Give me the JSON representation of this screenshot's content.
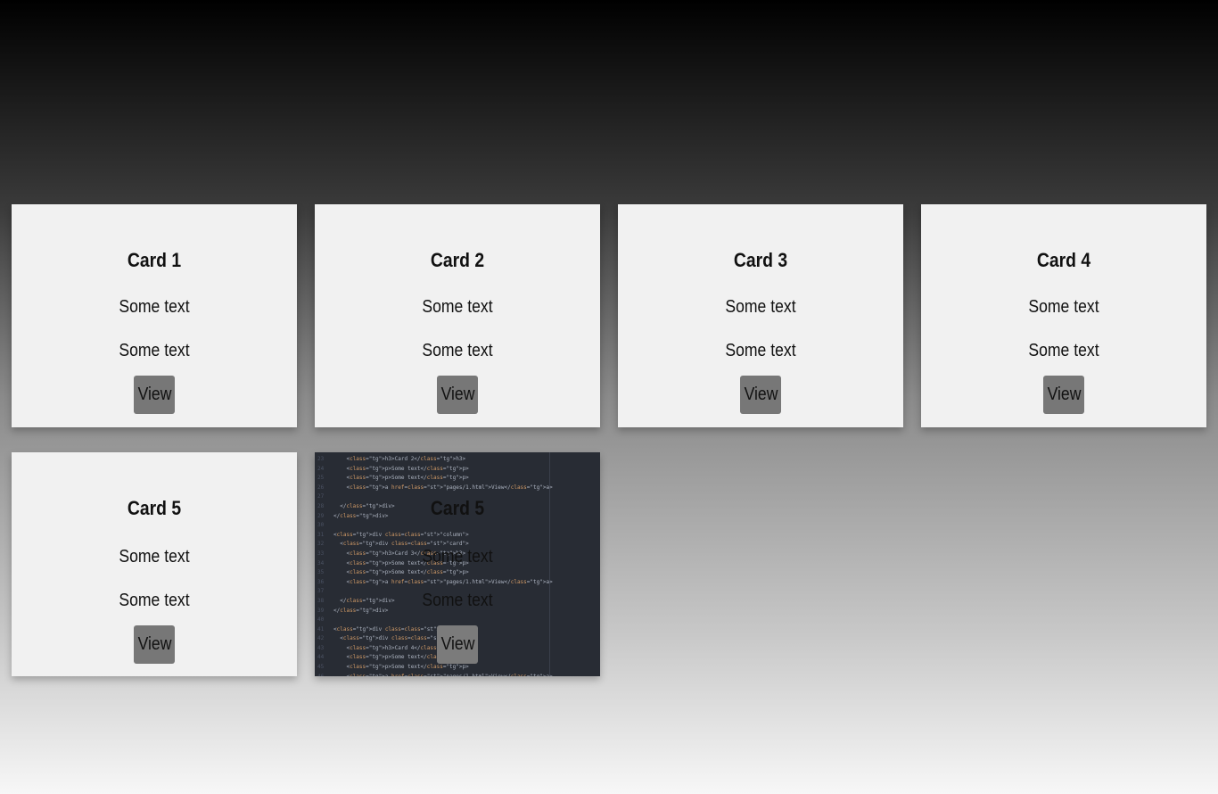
{
  "cards": [
    {
      "title": "Card 1",
      "text1": "Some text",
      "text2": "Some text",
      "button": "View"
    },
    {
      "title": "Card 2",
      "text1": "Some text",
      "text2": "Some text",
      "button": "View"
    },
    {
      "title": "Card 3",
      "text1": "Some text",
      "text2": "Some text",
      "button": "View"
    },
    {
      "title": "Card 4",
      "text1": "Some text",
      "text2": "Some text",
      "button": "View"
    },
    {
      "title": "Card 5",
      "text1": "Some text",
      "text2": "Some text",
      "button": "View"
    },
    {
      "title": "Card 5",
      "text1": "Some text",
      "text2": "Some text",
      "button": "View"
    }
  ],
  "code_overlay": {
    "lines": [
      {
        "n": "23",
        "code": "    <h3>Card 2</h3>"
      },
      {
        "n": "24",
        "code": "    <p>Some text</p>"
      },
      {
        "n": "25",
        "code": "    <p>Some text</p>"
      },
      {
        "n": "26",
        "code": "    <a href=\"pages/1.html\">View</a>"
      },
      {
        "n": "27",
        "code": ""
      },
      {
        "n": "28",
        "code": "  </div>"
      },
      {
        "n": "29",
        "code": "</div>"
      },
      {
        "n": "30",
        "code": ""
      },
      {
        "n": "31",
        "code": "<div class=\"column\">"
      },
      {
        "n": "32",
        "code": "  <div class=\"card\">"
      },
      {
        "n": "33",
        "code": "    <h3>Card 3</h3>"
      },
      {
        "n": "34",
        "code": "    <p>Some text</p>"
      },
      {
        "n": "35",
        "code": "    <p>Some text</p>"
      },
      {
        "n": "36",
        "code": "    <a href=\"pages/1.html\">View</a>"
      },
      {
        "n": "37",
        "code": ""
      },
      {
        "n": "38",
        "code": "  </div>"
      },
      {
        "n": "39",
        "code": "</div>"
      },
      {
        "n": "40",
        "code": ""
      },
      {
        "n": "41",
        "code": "<div class=\"column\">"
      },
      {
        "n": "42",
        "code": "  <div class=\"card\">"
      },
      {
        "n": "43",
        "code": "    <h3>Card 4</h3>"
      },
      {
        "n": "44",
        "code": "    <p>Some text</p>"
      },
      {
        "n": "45",
        "code": "    <p>Some text</p>"
      },
      {
        "n": "46",
        "code": "    <a href=\"pages/1.html\">View</a>"
      }
    ]
  },
  "colors": {
    "card_bg": "#f1f1f1",
    "button_bg": "#777777",
    "code_bg": "#282c34"
  }
}
